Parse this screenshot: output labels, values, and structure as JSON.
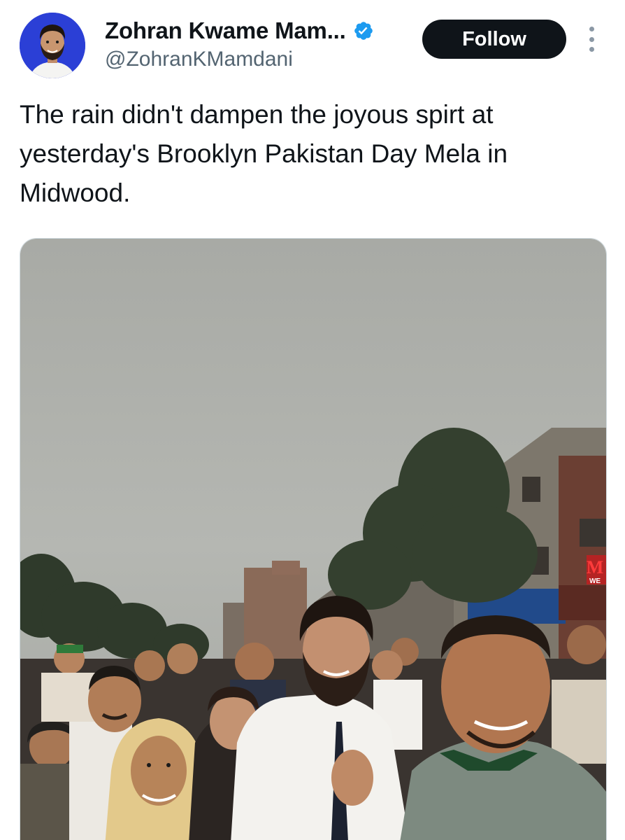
{
  "author": {
    "display_name": "Zohran Kwame Mam...",
    "handle": "@ZohranKMamdani",
    "verified": true,
    "avatar_bg": "#2b3fd6"
  },
  "actions": {
    "follow_label": "Follow",
    "more_icon": "more-vertical-icon"
  },
  "tweet": {
    "text": "The rain didn't dampen the joyous spirt at yesterday's Brooklyn Pakistan Day Mela in Midwood."
  },
  "photo": {
    "sign_letter": "M",
    "sign_sub": "WE"
  },
  "colors": {
    "text_primary": "#0f1419",
    "text_secondary": "#536471",
    "verified_blue": "#1d9bf0",
    "follow_bg": "#0f1419"
  }
}
